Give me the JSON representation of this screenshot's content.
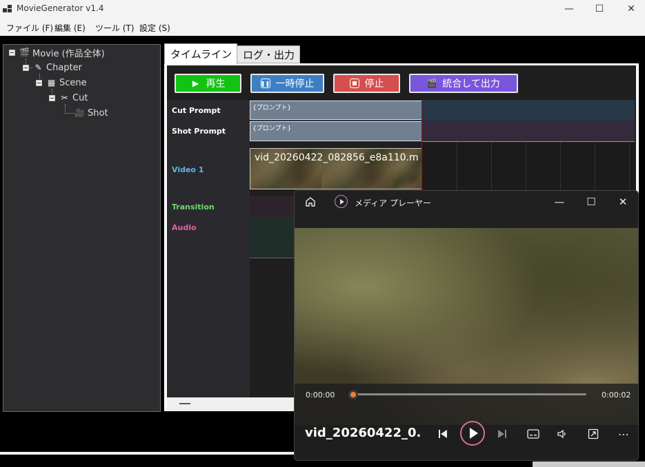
{
  "window": {
    "title": "MovieGenerator v1.4",
    "minimize": "—",
    "maximize": "☐",
    "close": "✕"
  },
  "menu": {
    "items": [
      "ファイル (F)",
      "編集 (E)",
      "ツール (T)",
      "設定 (S)"
    ]
  },
  "tree": {
    "nodes": [
      {
        "label": "Movie (作品全体)",
        "icon": "clapperboard-icon"
      },
      {
        "label": "Chapter",
        "icon": "pencil-icon"
      },
      {
        "label": "Scene",
        "icon": "film-icon"
      },
      {
        "label": "Cut",
        "icon": "scissors-icon"
      },
      {
        "label": "Shot",
        "icon": "camera-icon"
      }
    ]
  },
  "tabs": {
    "timeline": "タイムライン",
    "log": "ログ・出力"
  },
  "toolbar": {
    "play": "再生",
    "pause": "一時停止",
    "stop": "停止",
    "export": "統合して出力",
    "colors": {
      "play": "#13c313",
      "pause": "#3d7fc4",
      "stop": "#d64e4e",
      "export": "#7a55dd"
    }
  },
  "timeline": {
    "rows": [
      {
        "label": "Cut Prompt",
        "color": "#ffffff"
      },
      {
        "label": "Shot Prompt",
        "color": "#ffffff"
      },
      {
        "label": "Video 1",
        "color": "#5fb4e8"
      },
      {
        "label": "Transition",
        "color": "#6ddc6d"
      },
      {
        "label": "Audio",
        "color": "#e85fa0"
      }
    ],
    "cut_prompt_block": "{プロンプト}",
    "shot_prompt_block": "{プロンプト}",
    "video_clip_name": "vid_20260422_082856_e8a110.m"
  },
  "player": {
    "app_name": "メディア プレーヤー",
    "current_time": "0:00:00",
    "duration": "0:00:02",
    "progress": 0.0,
    "file_title": "vid_20260422_0...",
    "accent": "#f08030"
  }
}
